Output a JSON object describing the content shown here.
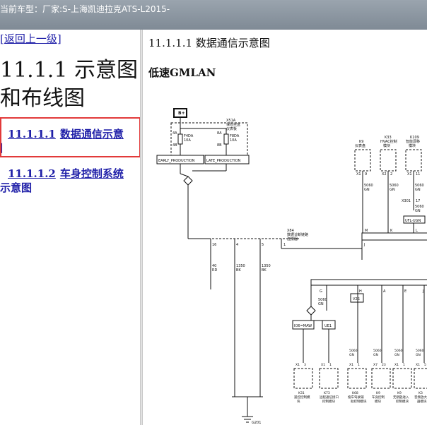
{
  "header": {
    "label": "当前车型：",
    "value": "厂家:S-上海凯迪拉克ATS-L2015-"
  },
  "sidebar": {
    "back_link": "[返回上一级]",
    "title_line1": "11.1.1 示意图",
    "title_line2": "和布线图",
    "items": [
      {
        "number": "11.1.1.1",
        "title": "数据通信示意",
        "title_cont": "图"
      },
      {
        "number": "11.1.1.2",
        "title": "车身控制系统",
        "title_cont": "示意图"
      }
    ]
  },
  "content": {
    "section_title": "11.1.1.1 数据通信示意图",
    "subsection_title": "低速GMLAN"
  },
  "diagram": {
    "fuse_source": "B+",
    "fuse_block_ref": "X51A",
    "fuse_block_name_1": "保险丝盒",
    "fuse_block_name_2": "仪表板",
    "fuse1": {
      "name": "F4DA",
      "amp": "10A",
      "pin_top": "4A",
      "pin_bottom": "4B"
    },
    "fuse2": {
      "name": "F8DA",
      "amp": "10A",
      "pin_top": "8A",
      "pin_bottom": "8B"
    },
    "variant_early": "EARLY_PRODUCTION",
    "variant_late": "LATE_PRODUCTION",
    "connector_ref": "X84",
    "connector_name_1": "数据诊断链路",
    "connector_name_2": "连接器",
    "connector_pins": [
      {
        "pin": "16",
        "wire": "40",
        "color": "RD"
      },
      {
        "pin": "4",
        "wire": "1350",
        "color": "BK"
      },
      {
        "pin": "5",
        "wire": "1350",
        "color": "BK"
      },
      {
        "pin": "1",
        "wire": "",
        "color": ""
      }
    ],
    "top_modules": [
      {
        "ref": "K9",
        "name1": "仪表盘",
        "name2": "",
        "pin_conn": "X1",
        "pin": "9",
        "wire": "5060",
        "color": "GN"
      },
      {
        "ref": "K33",
        "name1": "HVAC控制",
        "name2": "模块",
        "pin_conn": "X2",
        "pin": "2",
        "wire": "5060",
        "color": "GN"
      },
      {
        "ref": "K109",
        "name1": "智能源移",
        "name2": "模块",
        "pin_conn": "X1",
        "pin": "11",
        "wire": "5060",
        "color": "GN"
      }
    ],
    "inline_conn": {
      "ref": "X301",
      "pin": "17",
      "wire": "5060",
      "color": "GN"
    },
    "variant_ufl": "UFL-UGN",
    "bus1_labels": [
      "M",
      "K",
      "L"
    ],
    "bus1_join": "J",
    "bus2_labels": [
      "G",
      "H",
      "A",
      "E",
      "J"
    ],
    "bus2_wire": "5060",
    "bus2_color": "GN",
    "options": [
      "IO6=MAW",
      "UE1",
      "V2S"
    ],
    "bottom_modules": [
      {
        "ref": "K31",
        "name1": "遥控控制模",
        "name2": "块",
        "pin_conn": "X1",
        "pin": "3",
        "wire": "",
        "color": ""
      },
      {
        "ref": "K73",
        "name1": "远程通信接口",
        "name2": "控制模块",
        "pin_conn": "X1",
        "pin": "1",
        "wire": "",
        "color": ""
      },
      {
        "ref": "K68",
        "name1": "拖车驾驶辅",
        "name2": "助控制模块",
        "pin_conn": "X1",
        "pin": "1",
        "wire": "5060",
        "color": "GN"
      },
      {
        "ref": "K9",
        "name1": "车身控制",
        "name2": "模块",
        "pin_conn": "X7",
        "pin": "23",
        "wire": "5060",
        "color": "GN"
      },
      {
        "ref": "K9",
        "name1": "无钥匙进入",
        "name2": "控制模块",
        "pin_conn": "X1",
        "pin": "1",
        "wire": "5060",
        "color": "GN"
      },
      {
        "ref": "K3",
        "name1": "音频放大",
        "name2": "器模块",
        "pin_conn": "X1",
        "pin": "5",
        "wire": "5060",
        "color": "GN"
      }
    ],
    "ground_ref": "G201",
    "colors": {
      "highlight_border": "#e23a3a",
      "link": "#1f1fa8",
      "topbar": "#8a949e"
    }
  }
}
